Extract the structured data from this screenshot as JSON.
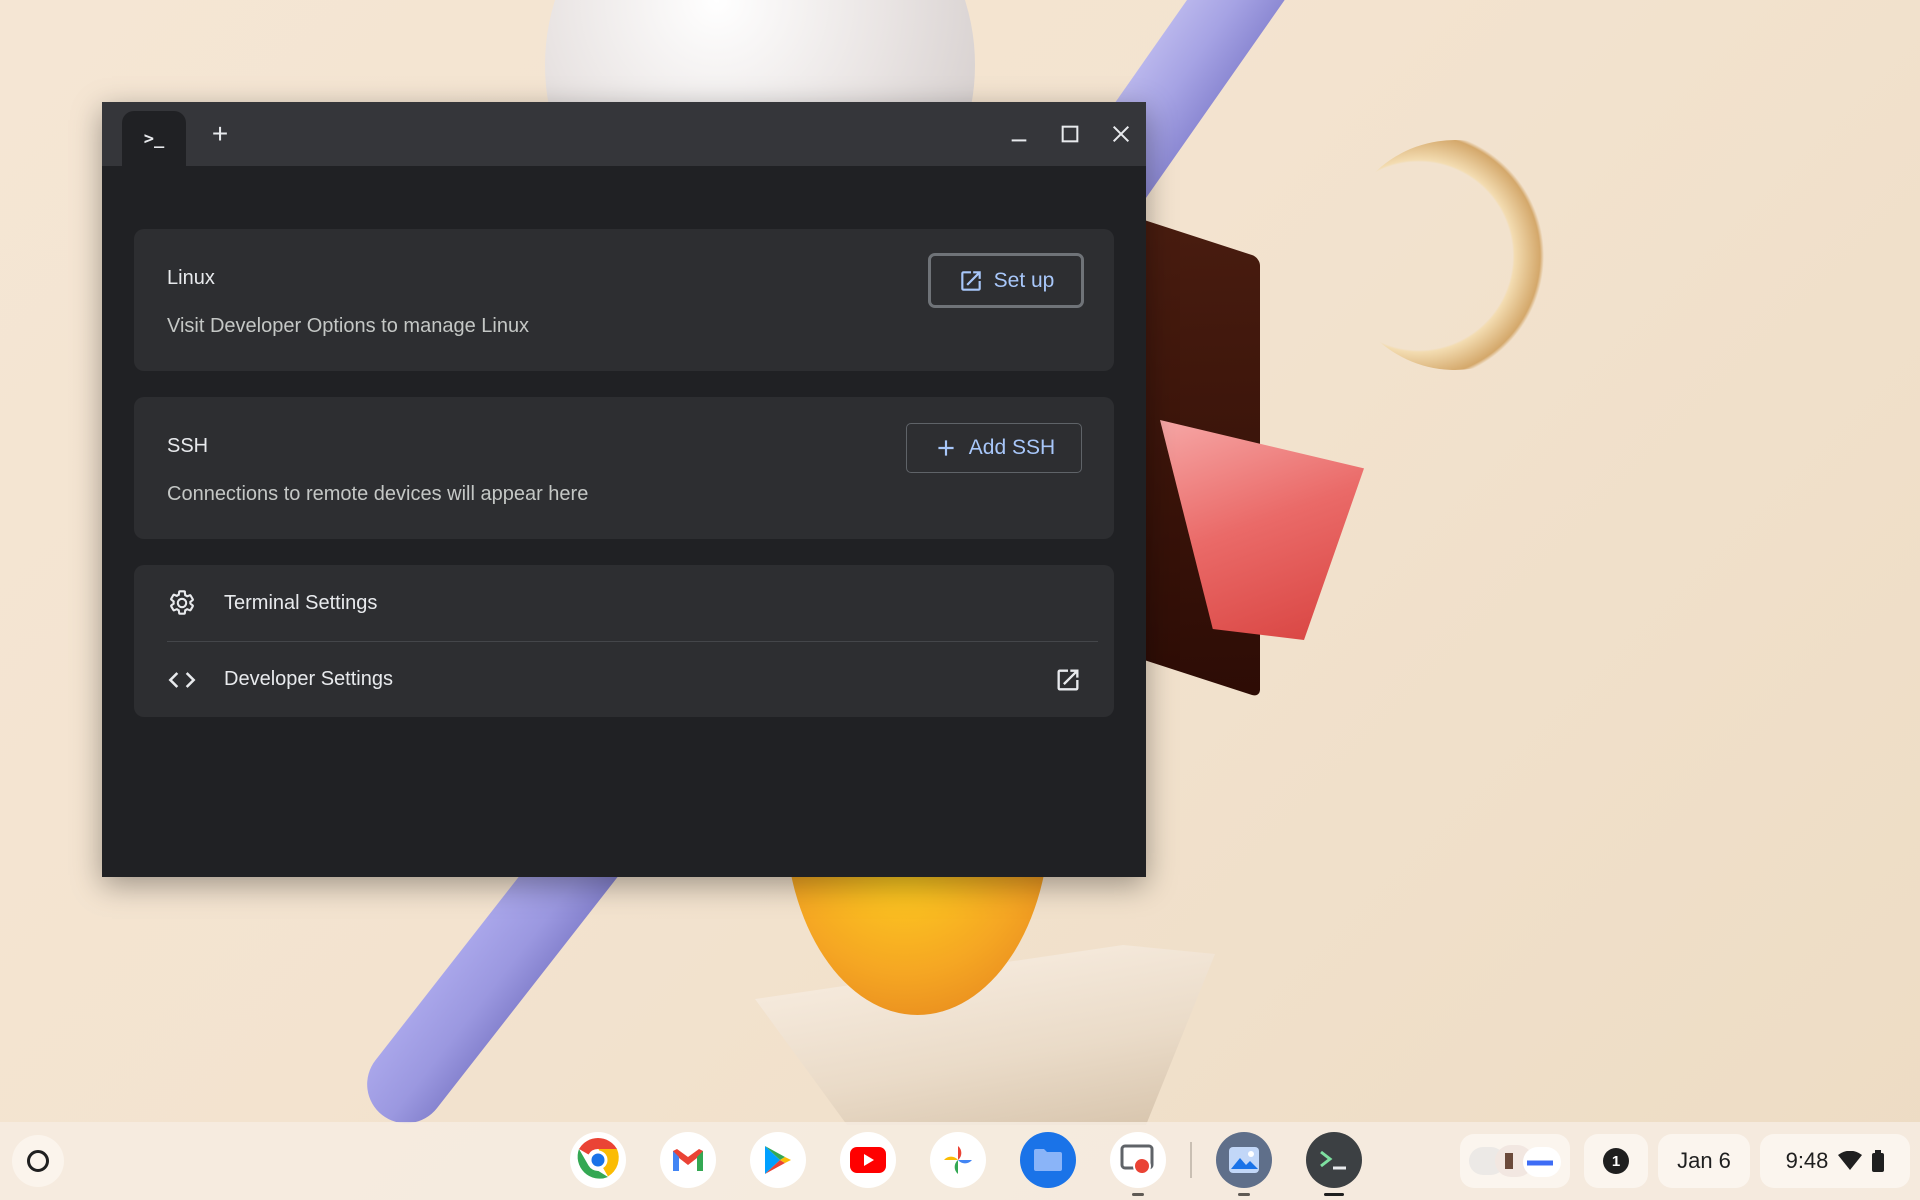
{
  "window": {
    "tab_glyph": ">_",
    "new_tab_glyph": "+",
    "controls": [
      "minimize-icon",
      "maximize-icon",
      "close-icon"
    ]
  },
  "linux": {
    "title": "Linux",
    "description": "Visit Developer Options to manage Linux",
    "button_label": "Set up"
  },
  "ssh": {
    "title": "SSH",
    "description": "Connections to remote devices will appear here",
    "button_label": "Add SSH"
  },
  "settings": {
    "terminal_settings": "Terminal Settings",
    "developer_settings": "Developer Settings"
  },
  "shelf": {
    "apps": [
      "chrome-icon",
      "gmail-icon",
      "play-store-icon",
      "youtube-icon",
      "photos-icon",
      "files-icon",
      "screencast-icon",
      "gallery-icon",
      "terminal-icon"
    ],
    "notification_count": "1",
    "date": "Jan 6",
    "time": "9:48"
  },
  "colors": {
    "window_bg": "#202124",
    "titlebar_bg": "#35363a",
    "card_bg": "#2d2e31",
    "accent": "#a8c7fa"
  }
}
